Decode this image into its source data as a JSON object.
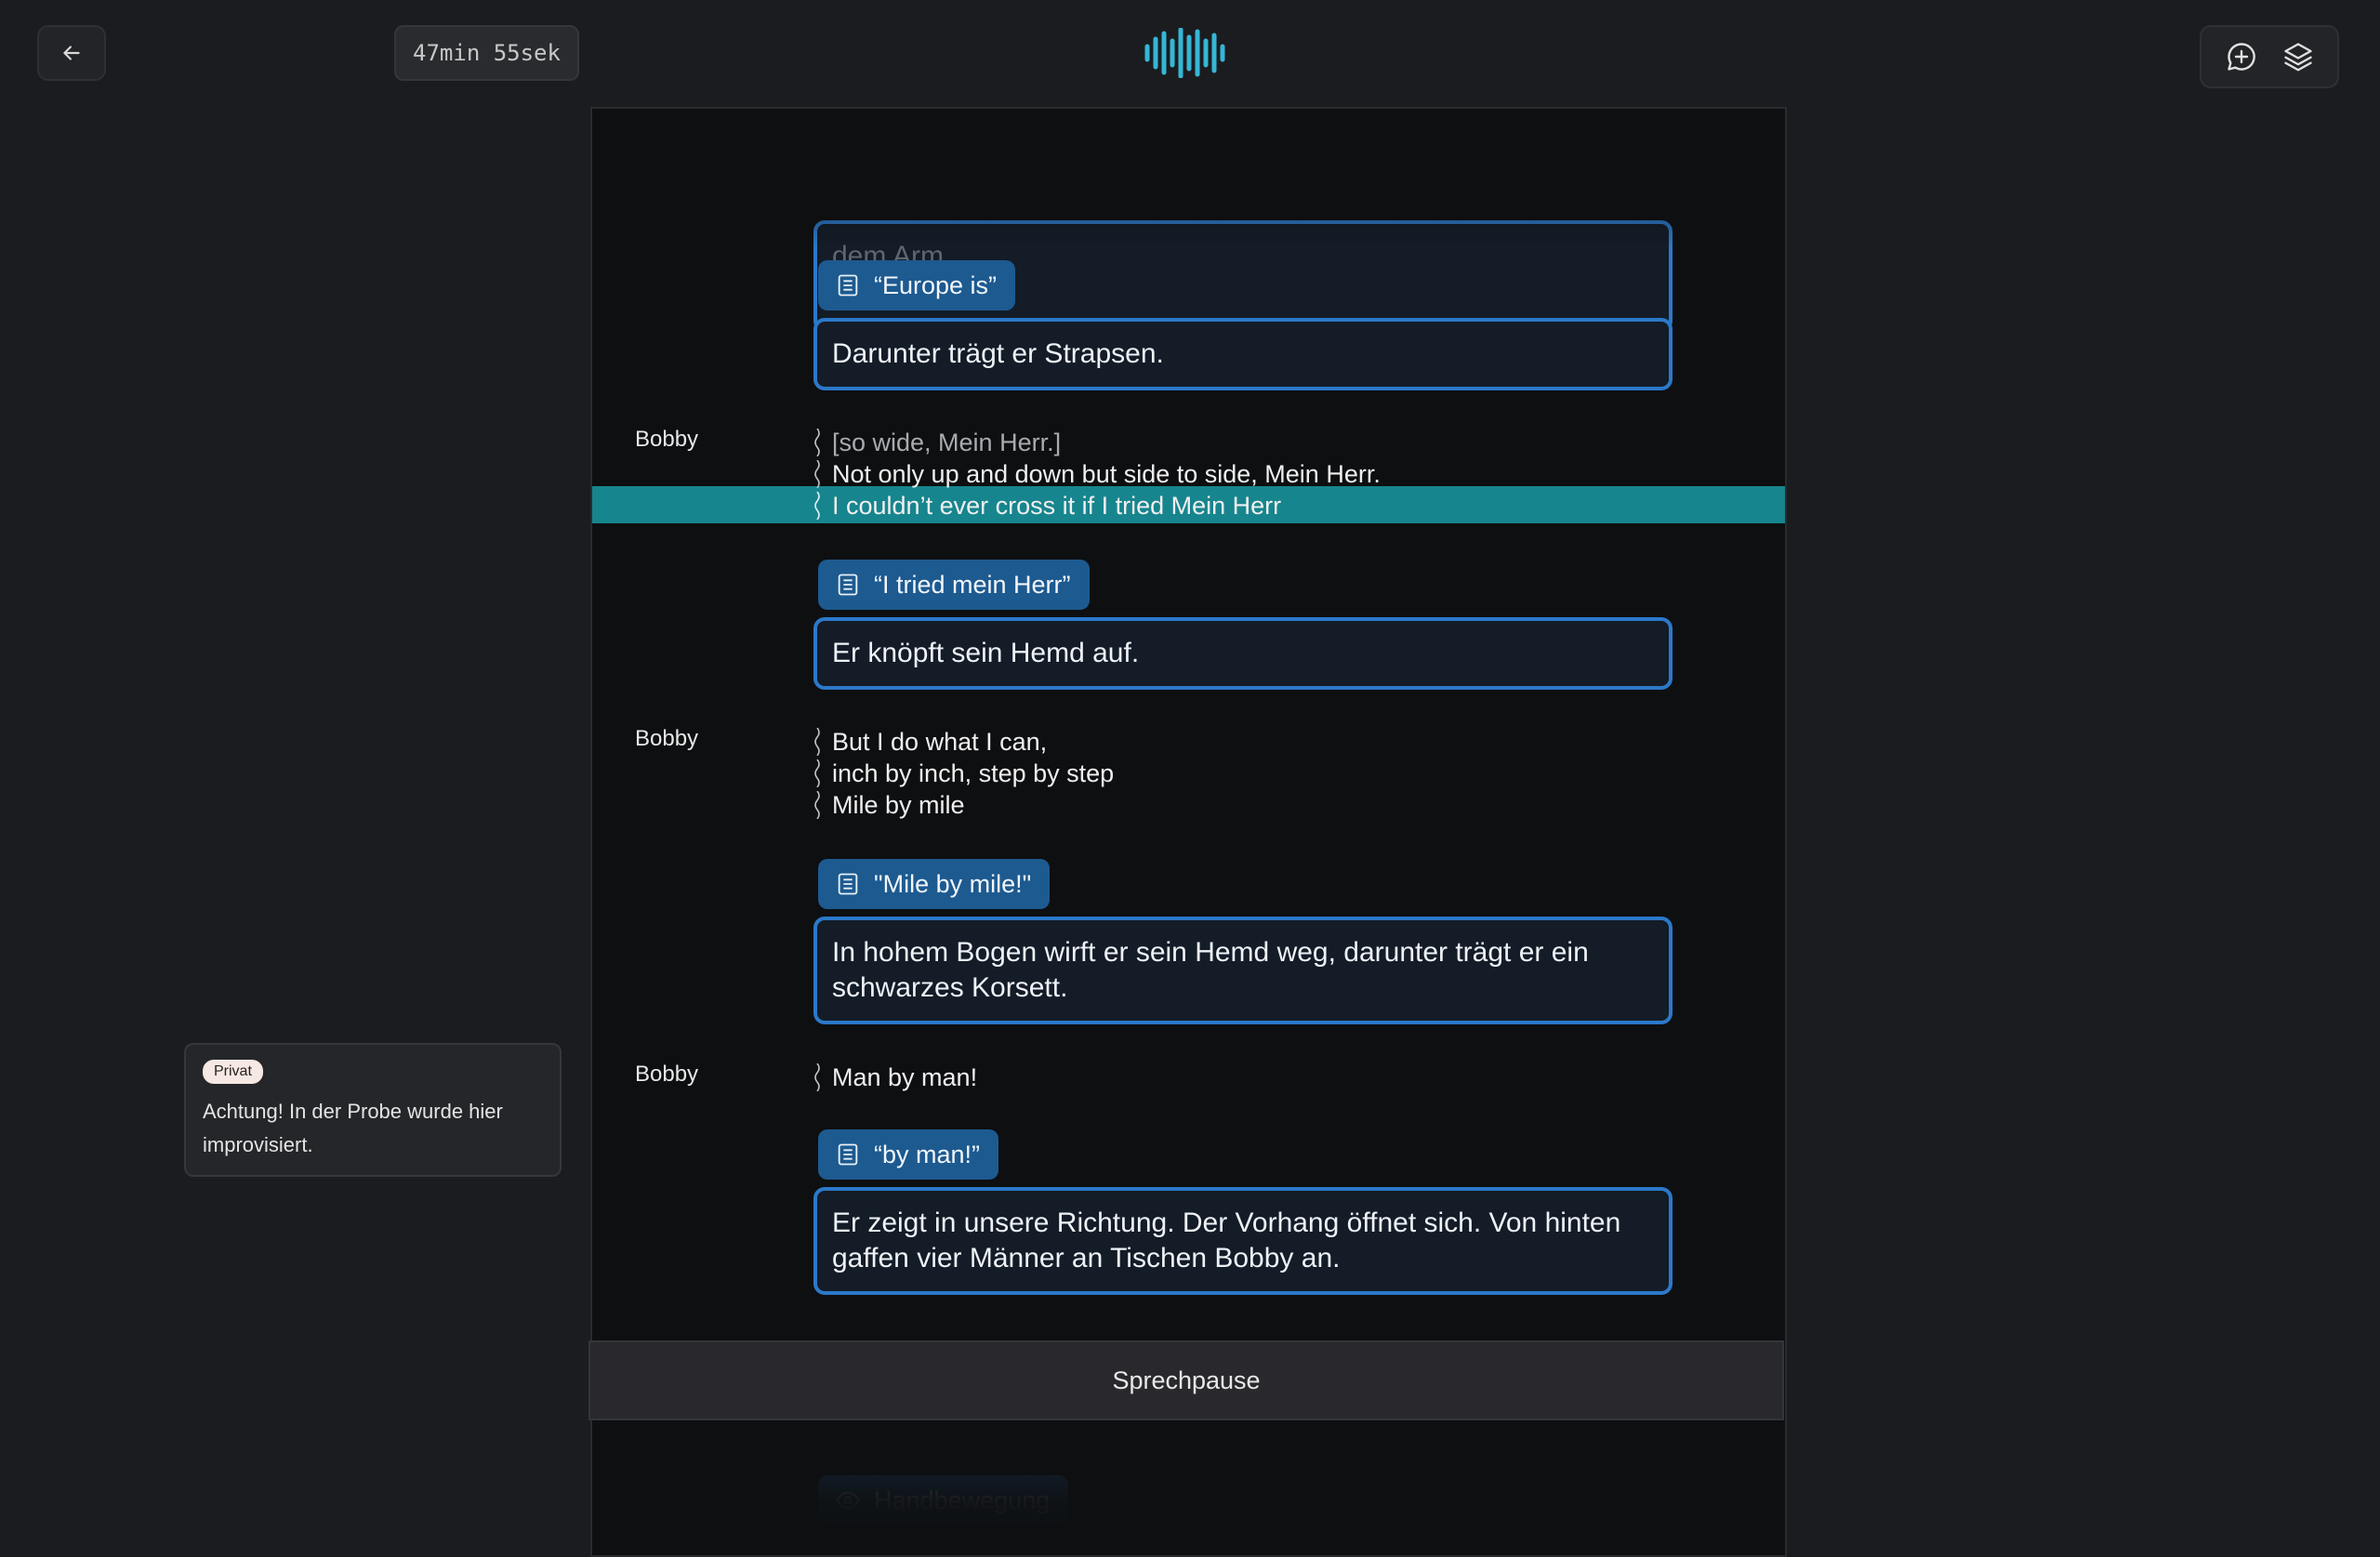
{
  "header": {
    "timer": "47min 55sek",
    "logo_icon": "waveform-logo-icon",
    "accent": "#36b6d6"
  },
  "script": {
    "top_fragment": "dem Arm.",
    "blocks": [
      {
        "cue_label": "“Europe is”",
        "cue_text": "Darunter trägt er Strapsen."
      },
      {
        "speaker": "Bobby",
        "lines": [
          "[so wide, Mein Herr.]",
          "Not only up and down but side to side, Mein Herr.",
          "I couldn’t ever cross it if I tried Mein Herr"
        ]
      },
      {
        "cue_label": "“I tried mein Herr”",
        "cue_text": "Er knöpft sein Hemd auf."
      },
      {
        "speaker": "Bobby",
        "lines": [
          "But I do what I can,",
          "inch by inch, step by step",
          "Mile by mile"
        ]
      },
      {
        "cue_label": "\"Mile by mile!\"",
        "cue_text": "In hohem Bogen wirft er sein Hemd weg, darunter trägt er ein schwarzes Korsett."
      },
      {
        "speaker": "Bobby",
        "lines": [
          "Man by man!"
        ]
      },
      {
        "cue_label": "“by man!”",
        "cue_text": "Er zeigt in unsere Richtung. Der Vorhang öffnet sich. Von hinten gaffen vier Männer an Tischen Bobby an."
      }
    ],
    "bottom_fragment": "Handbewegung",
    "highlight_color": "#17858e"
  },
  "pause_bar": {
    "label": "Sprechpause"
  },
  "note": {
    "badge": "Privat",
    "text": "Achtung! In der Probe wurde hier improvisiert."
  }
}
